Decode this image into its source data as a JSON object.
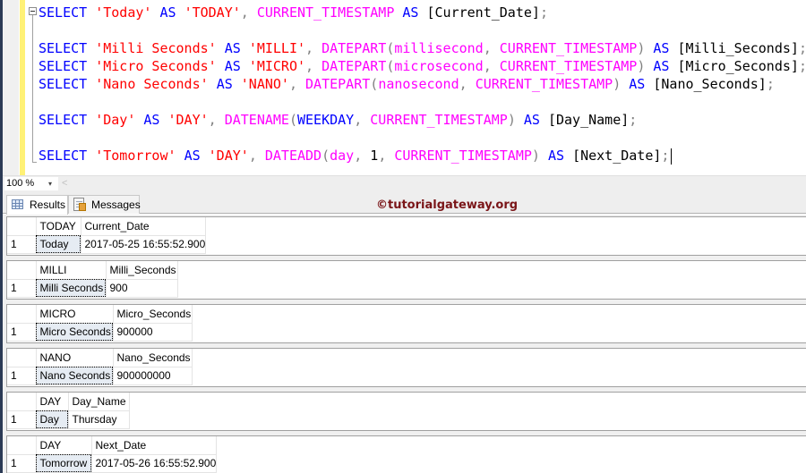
{
  "editor": {
    "lines": [
      {
        "tokens": [
          {
            "t": "SELECT",
            "c": "kw"
          },
          {
            "t": " ",
            "c": "id"
          },
          {
            "t": "'Today'",
            "c": "str"
          },
          {
            "t": " ",
            "c": "id"
          },
          {
            "t": "AS",
            "c": "kw"
          },
          {
            "t": " ",
            "c": "id"
          },
          {
            "t": "'TODAY'",
            "c": "str"
          },
          {
            "t": ", ",
            "c": "op"
          },
          {
            "t": "CURRENT_TIMESTAMP",
            "c": "fn"
          },
          {
            "t": " ",
            "c": "id"
          },
          {
            "t": "AS",
            "c": "kw"
          },
          {
            "t": " ",
            "c": "id"
          },
          {
            "t": "[Current_Date]",
            "c": "id"
          },
          {
            "t": ";",
            "c": "op"
          }
        ]
      },
      {
        "tokens": []
      },
      {
        "tokens": [
          {
            "t": "SELECT",
            "c": "kw"
          },
          {
            "t": " ",
            "c": "id"
          },
          {
            "t": "'Milli Seconds'",
            "c": "str"
          },
          {
            "t": " ",
            "c": "id"
          },
          {
            "t": "AS",
            "c": "kw"
          },
          {
            "t": " ",
            "c": "id"
          },
          {
            "t": "'MILLI'",
            "c": "str"
          },
          {
            "t": ", ",
            "c": "op"
          },
          {
            "t": "DATEPART",
            "c": "fn"
          },
          {
            "t": "(",
            "c": "op"
          },
          {
            "t": "millisecond",
            "c": "fn"
          },
          {
            "t": ", ",
            "c": "op"
          },
          {
            "t": "CURRENT_TIMESTAMP",
            "c": "fn"
          },
          {
            "t": ")",
            "c": "op"
          },
          {
            "t": " ",
            "c": "id"
          },
          {
            "t": "AS",
            "c": "kw"
          },
          {
            "t": " ",
            "c": "id"
          },
          {
            "t": "[Milli_Seconds]",
            "c": "id"
          },
          {
            "t": ";",
            "c": "op"
          }
        ]
      },
      {
        "tokens": [
          {
            "t": "SELECT",
            "c": "kw"
          },
          {
            "t": " ",
            "c": "id"
          },
          {
            "t": "'Micro Seconds'",
            "c": "str"
          },
          {
            "t": " ",
            "c": "id"
          },
          {
            "t": "AS",
            "c": "kw"
          },
          {
            "t": " ",
            "c": "id"
          },
          {
            "t": "'MICRO'",
            "c": "str"
          },
          {
            "t": ", ",
            "c": "op"
          },
          {
            "t": "DATEPART",
            "c": "fn"
          },
          {
            "t": "(",
            "c": "op"
          },
          {
            "t": "microsecond",
            "c": "fn"
          },
          {
            "t": ", ",
            "c": "op"
          },
          {
            "t": "CURRENT_TIMESTAMP",
            "c": "fn"
          },
          {
            "t": ")",
            "c": "op"
          },
          {
            "t": " ",
            "c": "id"
          },
          {
            "t": "AS",
            "c": "kw"
          },
          {
            "t": " ",
            "c": "id"
          },
          {
            "t": "[Micro_Seconds]",
            "c": "id"
          },
          {
            "t": ";",
            "c": "op"
          }
        ]
      },
      {
        "tokens": [
          {
            "t": "SELECT",
            "c": "kw"
          },
          {
            "t": " ",
            "c": "id"
          },
          {
            "t": "'Nano Seconds'",
            "c": "str"
          },
          {
            "t": " ",
            "c": "id"
          },
          {
            "t": "AS",
            "c": "kw"
          },
          {
            "t": " ",
            "c": "id"
          },
          {
            "t": "'NANO'",
            "c": "str"
          },
          {
            "t": ", ",
            "c": "op"
          },
          {
            "t": "DATEPART",
            "c": "fn"
          },
          {
            "t": "(",
            "c": "op"
          },
          {
            "t": "nanosecond",
            "c": "fn"
          },
          {
            "t": ", ",
            "c": "op"
          },
          {
            "t": "CURRENT_TIMESTAMP",
            "c": "fn"
          },
          {
            "t": ")",
            "c": "op"
          },
          {
            "t": " ",
            "c": "id"
          },
          {
            "t": "AS",
            "c": "kw"
          },
          {
            "t": " ",
            "c": "id"
          },
          {
            "t": "[Nano_Seconds]",
            "c": "id"
          },
          {
            "t": ";",
            "c": "op"
          }
        ]
      },
      {
        "tokens": []
      },
      {
        "tokens": [
          {
            "t": "SELECT",
            "c": "kw"
          },
          {
            "t": " ",
            "c": "id"
          },
          {
            "t": "'Day'",
            "c": "str"
          },
          {
            "t": " ",
            "c": "id"
          },
          {
            "t": "AS",
            "c": "kw"
          },
          {
            "t": " ",
            "c": "id"
          },
          {
            "t": "'DAY'",
            "c": "str"
          },
          {
            "t": ", ",
            "c": "op"
          },
          {
            "t": "DATENAME",
            "c": "fn"
          },
          {
            "t": "(",
            "c": "op"
          },
          {
            "t": "WEEKDAY",
            "c": "kw"
          },
          {
            "t": ", ",
            "c": "op"
          },
          {
            "t": "CURRENT_TIMESTAMP",
            "c": "fn"
          },
          {
            "t": ")",
            "c": "op"
          },
          {
            "t": " ",
            "c": "id"
          },
          {
            "t": "AS",
            "c": "kw"
          },
          {
            "t": " ",
            "c": "id"
          },
          {
            "t": "[Day_Name]",
            "c": "id"
          },
          {
            "t": ";",
            "c": "op"
          }
        ]
      },
      {
        "tokens": []
      },
      {
        "tokens": [
          {
            "t": "SELECT",
            "c": "kw"
          },
          {
            "t": " ",
            "c": "id"
          },
          {
            "t": "'Tomorrow'",
            "c": "str"
          },
          {
            "t": " ",
            "c": "id"
          },
          {
            "t": "AS",
            "c": "kw"
          },
          {
            "t": " ",
            "c": "id"
          },
          {
            "t": "'DAY'",
            "c": "str"
          },
          {
            "t": ", ",
            "c": "op"
          },
          {
            "t": "DATEADD",
            "c": "fn"
          },
          {
            "t": "(",
            "c": "op"
          },
          {
            "t": "day",
            "c": "fn"
          },
          {
            "t": ", ",
            "c": "op"
          },
          {
            "t": "1",
            "c": "num"
          },
          {
            "t": ", ",
            "c": "op"
          },
          {
            "t": "CURRENT_TIMESTAMP",
            "c": "fn"
          },
          {
            "t": ")",
            "c": "op"
          },
          {
            "t": " ",
            "c": "id"
          },
          {
            "t": "AS",
            "c": "kw"
          },
          {
            "t": " ",
            "c": "id"
          },
          {
            "t": "[Next_Date]",
            "c": "id"
          },
          {
            "t": ";",
            "c": "op"
          }
        ],
        "caret": true
      }
    ]
  },
  "zoom": {
    "value": "100 %",
    "arrow": "▾",
    "scroll_left": "<"
  },
  "tabs": {
    "results_label": "Results",
    "messages_label": "Messages"
  },
  "watermark": "©tutorialgateway.org",
  "result_sets": [
    {
      "columns": [
        "TODAY",
        "Current_Date"
      ],
      "rows": [
        [
          "1",
          "Today",
          "2017-05-25 16:55:52.900"
        ]
      ]
    },
    {
      "columns": [
        "MILLI",
        "Milli_Seconds"
      ],
      "rows": [
        [
          "1",
          "Milli Seconds",
          "900"
        ]
      ]
    },
    {
      "columns": [
        "MICRO",
        "Micro_Seconds"
      ],
      "rows": [
        [
          "1",
          "Micro Seconds",
          "900000"
        ]
      ]
    },
    {
      "columns": [
        "NANO",
        "Nano_Seconds"
      ],
      "rows": [
        [
          "1",
          "Nano Seconds",
          "900000000"
        ]
      ]
    },
    {
      "columns": [
        "DAY",
        "Day_Name"
      ],
      "rows": [
        [
          "1",
          "Day",
          "Thursday"
        ]
      ]
    },
    {
      "columns": [
        "DAY",
        "Next_Date"
      ],
      "rows": [
        [
          "1",
          "Tomorrow",
          "2017-05-26 16:55:52.900"
        ]
      ]
    }
  ],
  "colors": {
    "keyword": "#0000ff",
    "string": "#ff0000",
    "function": "#ff00ff",
    "operator": "#808080",
    "watermark": "#7a1518",
    "change_bar": "#fff176",
    "selected_cell": "#e6ecf3"
  }
}
